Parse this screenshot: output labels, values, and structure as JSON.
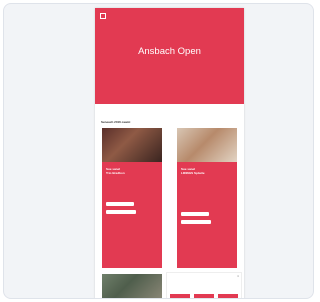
{
  "header": {
    "nav": [
      "",
      "",
      ""
    ],
    "right": ""
  },
  "hero": {
    "title": "Ansbach Open",
    "date": ""
  },
  "section": {
    "label": "Seneach 2016 caamt"
  },
  "shows": [
    {
      "text": "Sue sanel",
      "sub": "Trio Bredbon"
    },
    {
      "text": "Sue sanel",
      "sub": "LIINNGS Spiwite"
    }
  ],
  "colors": {
    "brand": "#e23a52",
    "background": "#f2f4f7"
  },
  "icons": [
    "logo-icon",
    "close-icon"
  ]
}
